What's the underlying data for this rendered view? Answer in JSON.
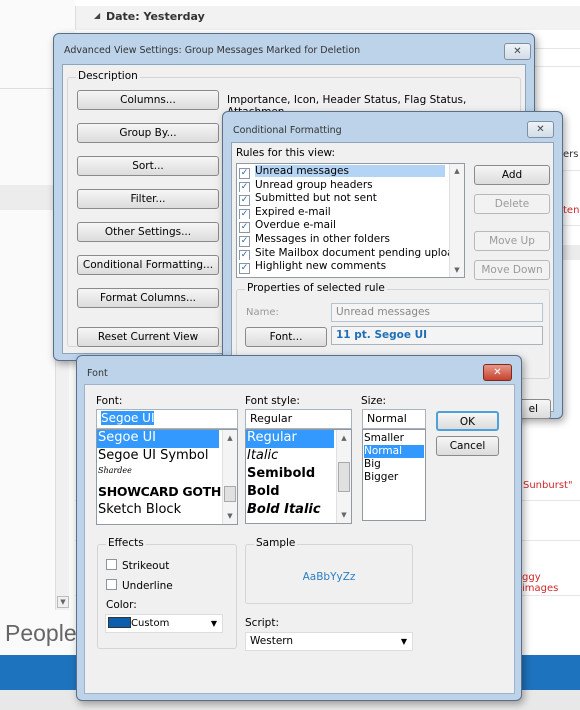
{
  "background": {
    "group_header": "Date: Yesterday",
    "people_label": "People",
    "snippets": [
      "ers",
      "ten",
      "Sunburst\"",
      "ggy images"
    ],
    "accent_color": "#1e73be"
  },
  "advanced": {
    "title": "Advanced View Settings: Group Messages Marked for Deletion",
    "group_label": "Description",
    "buttons": [
      {
        "label": "Columns...",
        "desc": "Importance, Icon, Header Status, Flag Status, Attachmen..."
      },
      {
        "label": "Group By..."
      },
      {
        "label": "Sort..."
      },
      {
        "label": "Filter..."
      },
      {
        "label": "Other Settings..."
      },
      {
        "label": "Conditional Formatting..."
      },
      {
        "label": "Format Columns..."
      },
      {
        "label": "Reset Current View"
      }
    ],
    "close_label": "✕"
  },
  "conditional": {
    "title": "Conditional Formatting",
    "rules_label": "Rules for this view:",
    "rules": [
      {
        "label": "Unread messages",
        "checked": true,
        "selected": true
      },
      {
        "label": "Unread group headers",
        "checked": true
      },
      {
        "label": "Submitted but not sent",
        "checked": true
      },
      {
        "label": "Expired e-mail",
        "checked": true
      },
      {
        "label": "Overdue e-mail",
        "checked": true
      },
      {
        "label": "Messages in other folders",
        "checked": true
      },
      {
        "label": "Site Mailbox document pending uploa",
        "checked": true
      },
      {
        "label": "Highlight new comments",
        "checked": true
      }
    ],
    "add": "Add",
    "delete": "Delete",
    "move_up": "Move Up",
    "move_down": "Move Down",
    "props_label": "Properties of selected rule",
    "name_label": "Name:",
    "name_value": "Unread messages",
    "font_button": "Font...",
    "font_value": "11 pt. Segoe UI",
    "cancel_partial": "el",
    "close_label": "✕"
  },
  "font": {
    "title": "Font",
    "font_label": "Font:",
    "font_value": "Segoe UI",
    "fonts": [
      "Segoe UI",
      "Segoe UI Symbol",
      "Shardee",
      "SHOWCARD GOTHI",
      "Sketch Block"
    ],
    "style_label": "Font style:",
    "style_value": "Regular",
    "styles": [
      "Regular",
      "Italic",
      "Semibold",
      "Bold",
      "Bold Italic"
    ],
    "size_label": "Size:",
    "size_value": "Normal",
    "sizes": [
      "Smaller",
      "Normal",
      "Big",
      "Bigger"
    ],
    "ok": "OK",
    "cancel": "Cancel",
    "effects_label": "Effects",
    "strikeout": "Strikeout",
    "underline": "Underline",
    "color_label": "Color:",
    "color_value": "Custom",
    "color_swatch": "#0b5fad",
    "sample_label": "Sample",
    "sample_text": "AaBbYyZz",
    "script_label": "Script:",
    "script_value": "Western",
    "close_label": "✕"
  }
}
